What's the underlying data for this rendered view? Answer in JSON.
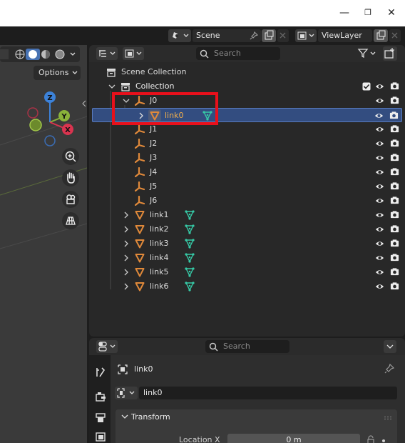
{
  "window": {
    "minimize": "—",
    "maximize": "❐",
    "close": "✕"
  },
  "topbar": {
    "scene": "Scene",
    "view_layer": "ViewLayer"
  },
  "viewport": {
    "options_label": "Options",
    "axes": {
      "x": "X",
      "y": "Y",
      "z": "Z"
    }
  },
  "outliner": {
    "search_placeholder": "Search",
    "scene_collection": "Scene Collection",
    "collection": "Collection",
    "rows": [
      {
        "label": "J0"
      },
      {
        "label": "link0"
      },
      {
        "label": "J1"
      },
      {
        "label": "J2"
      },
      {
        "label": "J3"
      },
      {
        "label": "J4"
      },
      {
        "label": "J5"
      },
      {
        "label": "J6"
      },
      {
        "label": "link1"
      },
      {
        "label": "link2"
      },
      {
        "label": "link3"
      },
      {
        "label": "link4"
      },
      {
        "label": "link5"
      },
      {
        "label": "link6"
      }
    ]
  },
  "properties": {
    "search_placeholder": "Search",
    "object_name": "link0",
    "data_name": "link0",
    "transform_label": "Transform",
    "location_x_label": "Location X",
    "location_x_value": "0 m"
  },
  "colors": {
    "accent_selected_row": "#334d80",
    "object_orange": "#e0893a",
    "mesh_teal": "#36c9a6",
    "highlight_red": "#e8101b"
  }
}
